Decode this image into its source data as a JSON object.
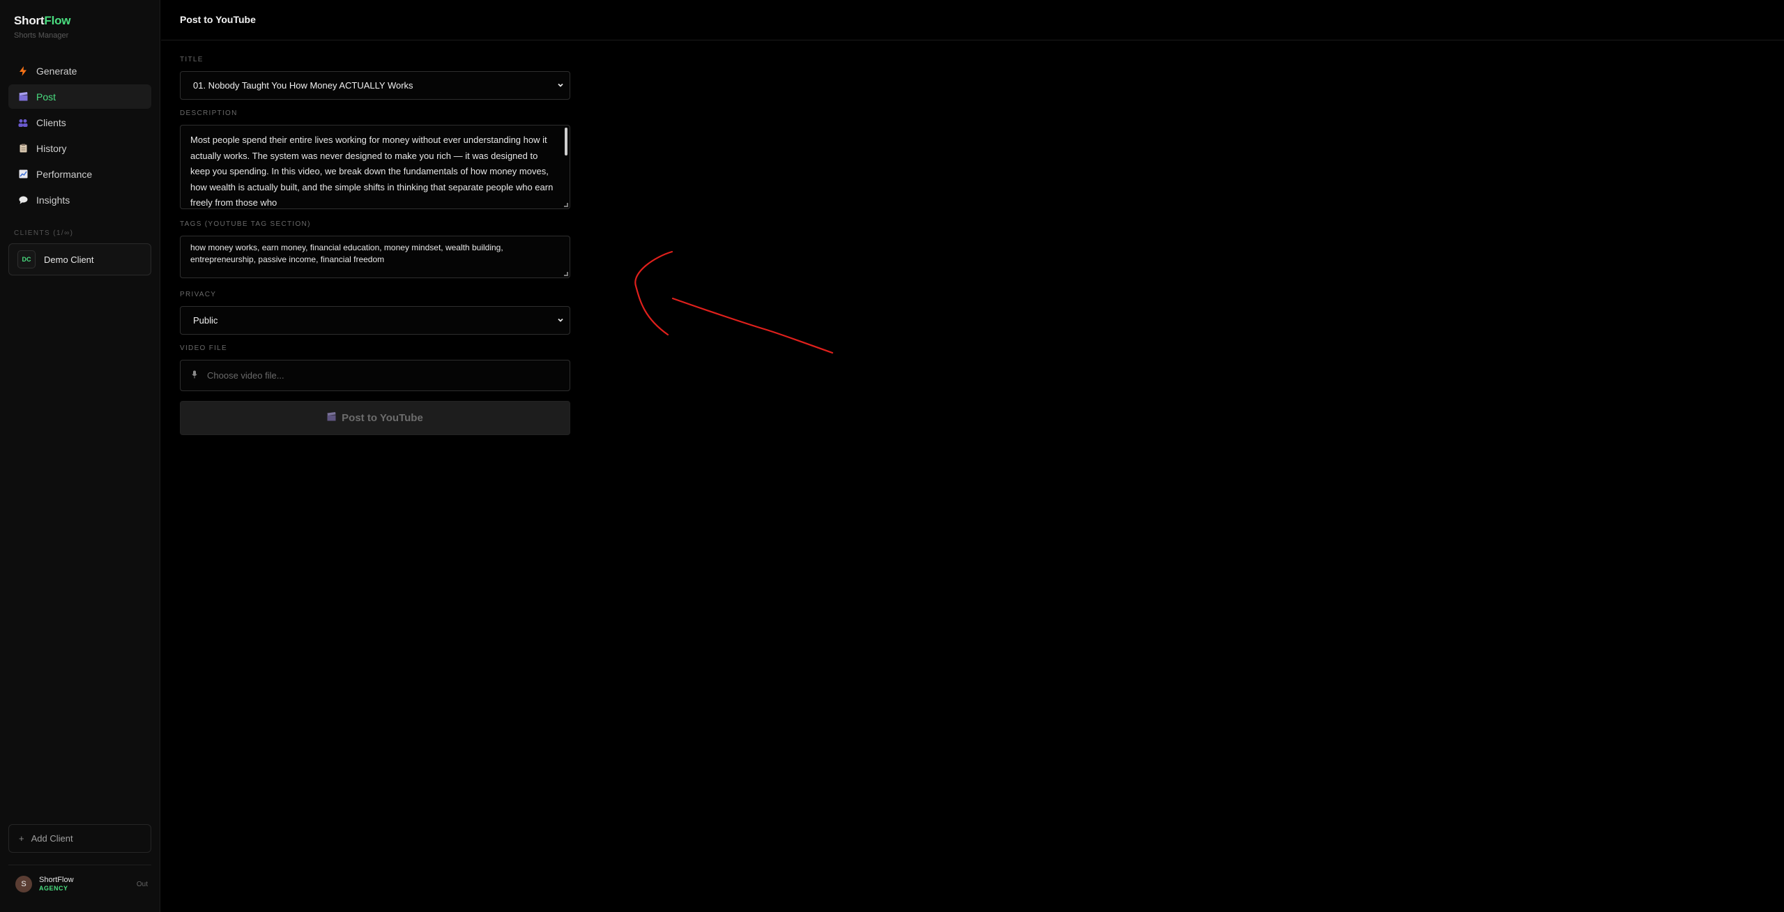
{
  "app": {
    "brand_main": "Short",
    "brand_accent": "Flow",
    "brand_subtitle": "Shorts Manager"
  },
  "sidebar": {
    "nav": [
      {
        "label": "Generate",
        "icon": "lightning-icon",
        "active": false
      },
      {
        "label": "Post",
        "icon": "clapperboard-icon",
        "active": true
      },
      {
        "label": "Clients",
        "icon": "users-icon",
        "active": false
      },
      {
        "label": "History",
        "icon": "clipboard-icon",
        "active": false
      },
      {
        "label": "Performance",
        "icon": "chart-up-icon",
        "active": false
      },
      {
        "label": "Insights",
        "icon": "speech-bubble-icon",
        "active": false
      }
    ],
    "clients_label": "CLIENTS (1/∞)",
    "clients": [
      {
        "initials": "DC",
        "name": "Demo Client"
      }
    ],
    "add_client": "Add Client",
    "user": {
      "avatar_letter": "S",
      "name": "ShortFlow",
      "plan": "AGENCY",
      "logout": "Out"
    }
  },
  "header": {
    "title": "Post to YouTube"
  },
  "form": {
    "title_label": "TITLE",
    "title_value": "01. Nobody Taught You How Money ACTUALLY Works",
    "description_label": "DESCRIPTION",
    "description_value": "Most people spend their entire lives working for money without ever understanding how it actually works. The system was never designed to make you rich — it was designed to keep you spending. In this video, we break down the fundamentals of how money moves, how wealth is actually built, and the simple shifts in thinking that separate people who earn freely from those who",
    "tags_label": "TAGS (YOUTUBE TAG SECTION)",
    "tags_value": "how money works, earn money, financial education, money mindset, wealth building, entrepreneurship, passive income, financial freedom",
    "privacy_label": "PRIVACY",
    "privacy_value": "Public",
    "video_label": "VIDEO FILE",
    "video_placeholder": "Choose video file...",
    "submit_label": "Post to YouTube"
  },
  "colors": {
    "accent": "#4ade80",
    "background": "#000000",
    "sidebar": "#0d0d0d",
    "annotation": "#e0201c"
  }
}
